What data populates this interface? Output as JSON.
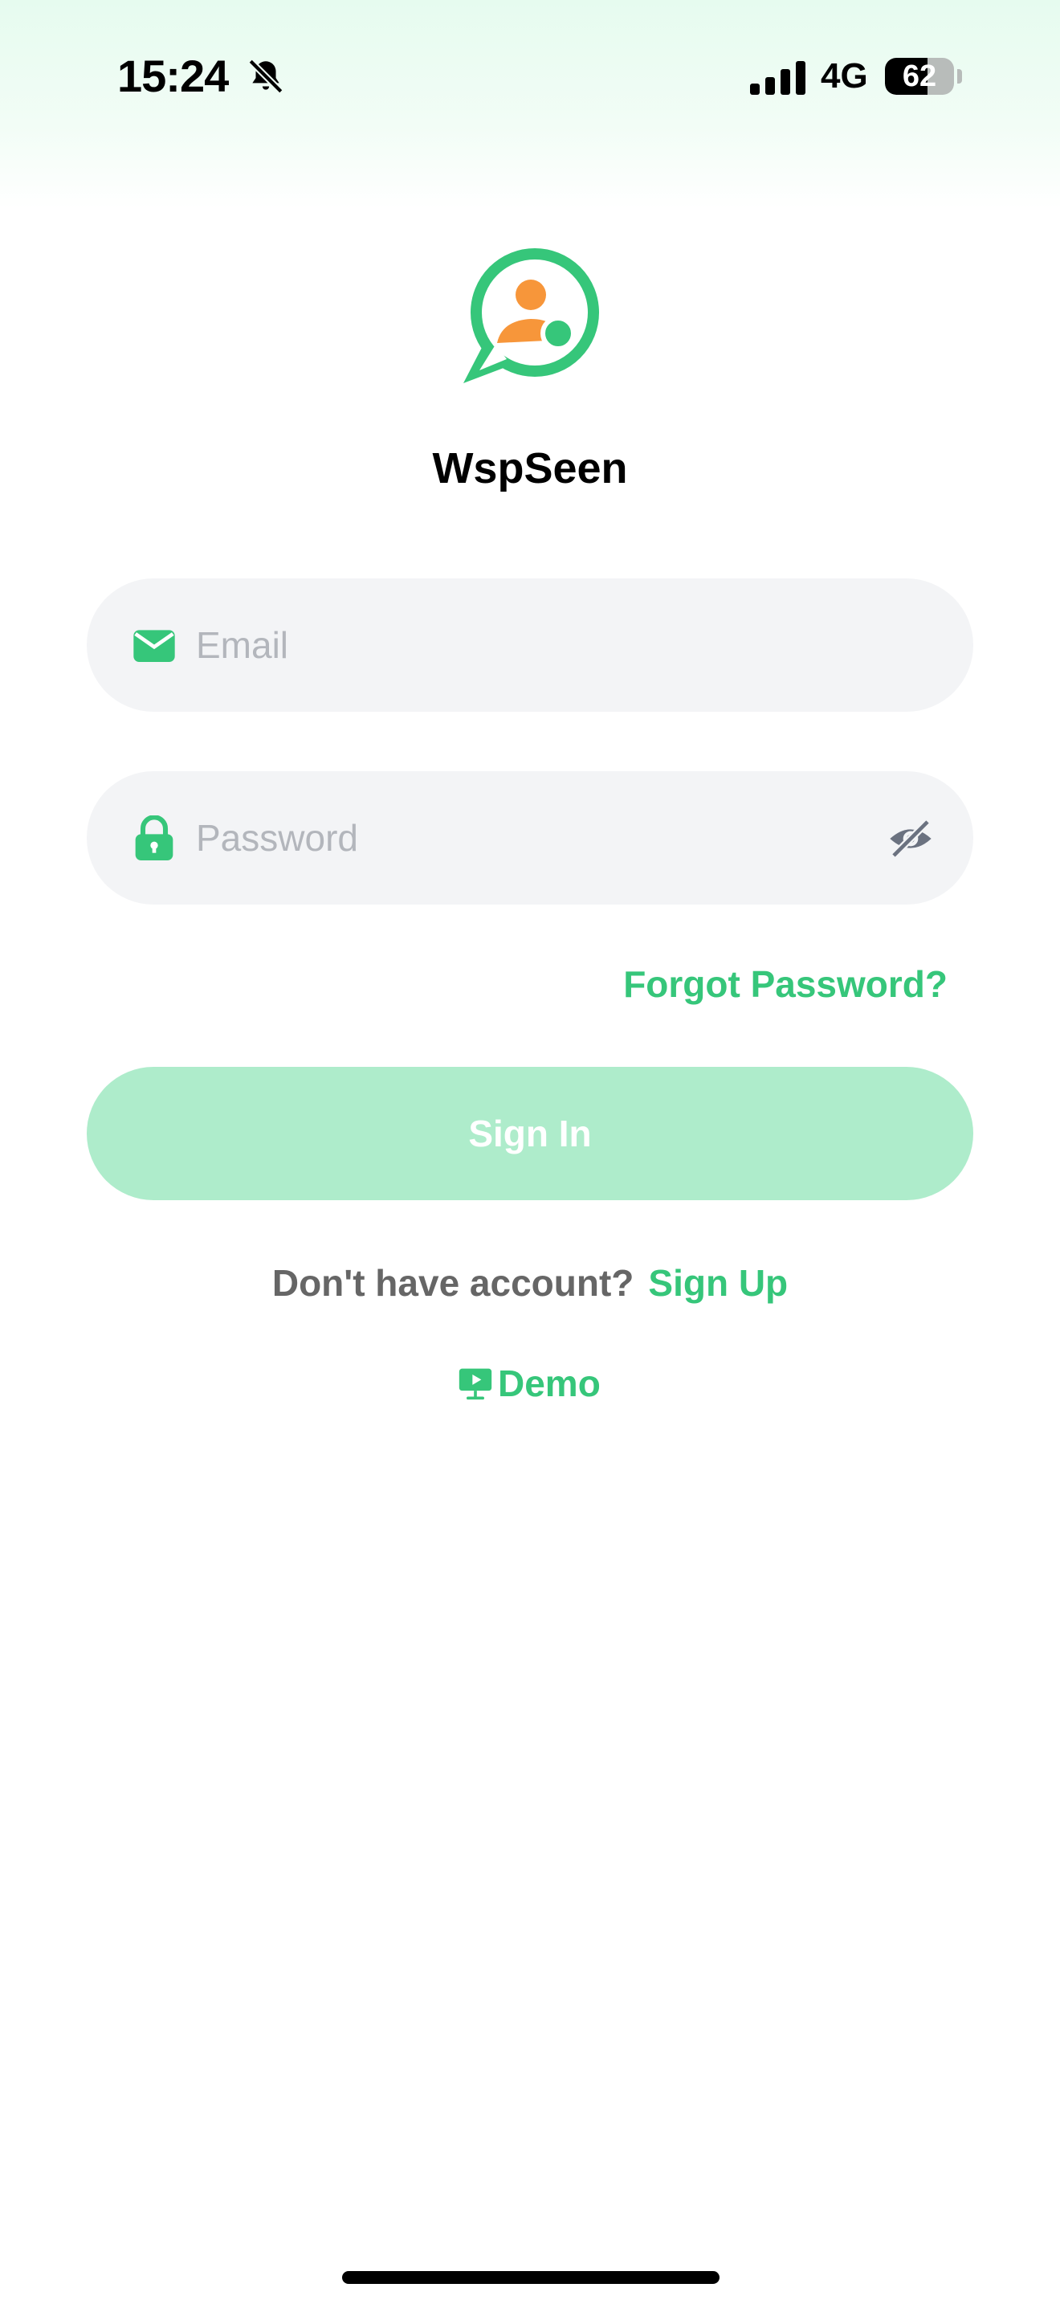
{
  "status_bar": {
    "time": "15:24",
    "network": "4G",
    "battery_level": "62",
    "battery_fraction": 0.62
  },
  "app": {
    "name": "WspSeen",
    "brand_color": "#36c67a",
    "accent_color": "#f7963a"
  },
  "login_form": {
    "email_placeholder": "Email",
    "email_value": "",
    "password_placeholder": "Password",
    "password_value": "",
    "forgot_password_label": "Forgot Password?",
    "sign_in_label": "Sign In",
    "signup_prompt": "Don't have account?",
    "signup_label": "Sign Up",
    "demo_label": "Demo"
  },
  "icons": {
    "email": "envelope-icon",
    "password": "lock-icon",
    "visibility": "eye-slash-icon",
    "demo": "monitor-play-icon",
    "notifications": "bell-slash-icon"
  }
}
